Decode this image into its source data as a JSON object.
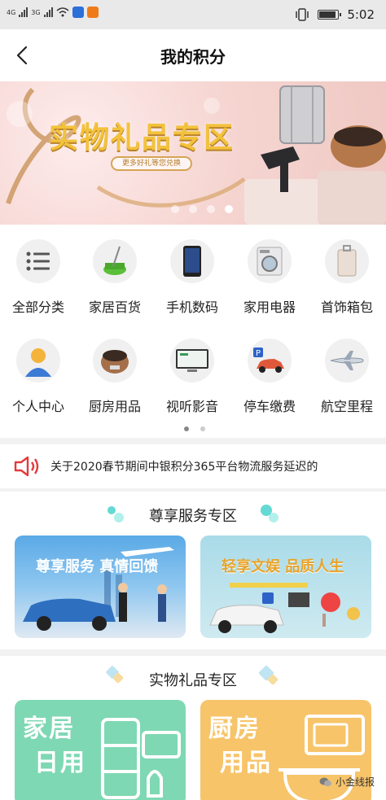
{
  "status_bar": {
    "network_1": "4G",
    "network_2": "3G",
    "time": "5:02"
  },
  "header": {
    "title": "我的积分"
  },
  "banner": {
    "title": "实物礼品专区",
    "subtitle": "更多好礼等您兑换",
    "slides": 4,
    "active_slide": 4
  },
  "categories": [
    {
      "label": "全部分类",
      "icon": "list-icon"
    },
    {
      "label": "家居百货",
      "icon": "mop-bucket-icon"
    },
    {
      "label": "手机数码",
      "icon": "smartphone-icon"
    },
    {
      "label": "家用电器",
      "icon": "washing-machine-icon"
    },
    {
      "label": "首饰箱包",
      "icon": "suitcase-icon"
    },
    {
      "label": "个人中心",
      "icon": "user-icon"
    },
    {
      "label": "厨房用品",
      "icon": "rice-cooker-icon"
    },
    {
      "label": "视听影音",
      "icon": "tv-icon"
    },
    {
      "label": "停车缴费",
      "icon": "parking-car-icon"
    },
    {
      "label": "航空里程",
      "icon": "airplane-icon"
    }
  ],
  "notice": {
    "text": "关于2020春节期间中银积分365平台物流服务延迟的"
  },
  "premium": {
    "title": "尊享服务专区",
    "cards": [
      {
        "label": "尊享服务 真情回馈"
      },
      {
        "label": "轻享文娱 品质人生"
      }
    ]
  },
  "gifts": {
    "title": "实物礼品专区",
    "cards": [
      {
        "line1": "家居",
        "line2": "日用"
      },
      {
        "line1": "厨房",
        "line2": "用品"
      }
    ]
  },
  "watermark": "小金线报",
  "colors": {
    "accent_red": "#e23b3b",
    "teal_deco": "#3ed0c8",
    "green_card": "#7ed8b3",
    "yellow_card": "#f7c46a"
  }
}
